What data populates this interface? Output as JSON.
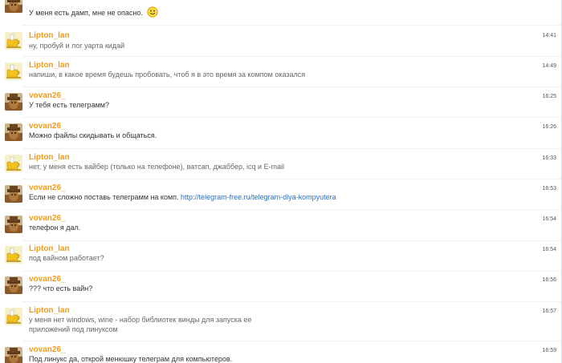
{
  "messages": [
    {
      "id": "m0",
      "author": "",
      "time": "",
      "text": "У меня есть дамп, мне не опасно.",
      "avatar": "vovan",
      "has_smiley": true
    },
    {
      "id": "m1",
      "author": "Lipton_lan",
      "time": "14:41",
      "text": "ну, пробуй и лог уарта кидай",
      "avatar": "lipton"
    },
    {
      "id": "m2",
      "author": "Lipton_lan",
      "time": "14:49",
      "text": "напиши, в какое время будешь пробовать, чтоб я в это время за компом оказался",
      "avatar": "lipton"
    },
    {
      "id": "m3",
      "author": "vovan26_",
      "time": "16:25",
      "text": "У тебя есть телеграмм?",
      "avatar": "vovan"
    },
    {
      "id": "m4",
      "author": "vovan26_",
      "time": "16:26",
      "text": "Можно файлы скидывать и общаться.",
      "avatar": "vovan"
    },
    {
      "id": "m5",
      "author": "Lipton_lan",
      "time": "16:33",
      "text": "нет, у меня есть вайбер (только на телефоне), ватсап, джаббер, icq и E-mail",
      "avatar": "lipton"
    },
    {
      "id": "m6",
      "author": "vovan26_",
      "time": "16:53",
      "text": "Если не сложно поставь телеграмм на комп.",
      "link": "http://telegram-free.ru/telegram-dlya-kompyutera",
      "avatar": "vovan"
    },
    {
      "id": "m7",
      "author": "vovan26_",
      "time": "16:54",
      "text": "телефон я дал.",
      "avatar": "vovan"
    },
    {
      "id": "m8",
      "author": "Lipton_lan",
      "time": "16:54",
      "text": "под вайном работает?",
      "avatar": "lipton"
    },
    {
      "id": "m9",
      "author": "vovan26_",
      "time": "16:56",
      "text": "??? что есть вайн?",
      "avatar": "vovan"
    },
    {
      "id": "m10",
      "author": "Lipton_lan",
      "time": "16:57",
      "text": "у меня нет windows, wine - набор библиотек винды для запуска ее приложений под линуксом",
      "avatar": "lipton"
    },
    {
      "id": "m11",
      "author": "vovan26_",
      "time": "16:59",
      "text": "Под линукс да, открой менюшку телеграм для компьютеров.",
      "avatar": "vovan"
    }
  ]
}
